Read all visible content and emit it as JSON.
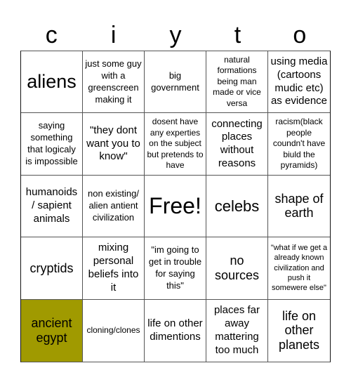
{
  "title_letters": [
    "c",
    "i",
    "y",
    "t",
    "o"
  ],
  "marked_color": "#a09a00",
  "cells": [
    {
      "text": "aliens",
      "marked": false
    },
    {
      "text": "just some guy with a greenscreen making it",
      "marked": false
    },
    {
      "text": "big government",
      "marked": false
    },
    {
      "text": "natural formations being man made or vice versa",
      "marked": false
    },
    {
      "text": "using media (cartoons mudic etc) as evidence",
      "marked": false
    },
    {
      "text": "saying something that logicaly is impossible",
      "marked": false
    },
    {
      "text": "\"they dont want you to know\"",
      "marked": false
    },
    {
      "text": "dosent have any experties on the subject but pretends to have",
      "marked": false
    },
    {
      "text": "connecting places without reasons",
      "marked": false
    },
    {
      "text": "racism(black people coundn't have biuld the pyramids)",
      "marked": false
    },
    {
      "text": "humanoids / sapient animals",
      "marked": false
    },
    {
      "text": "non existing/ alien antient civilization",
      "marked": false
    },
    {
      "text": "Free!",
      "marked": false
    },
    {
      "text": "celebs",
      "marked": false
    },
    {
      "text": "shape of earth",
      "marked": false
    },
    {
      "text": "cryptids",
      "marked": false
    },
    {
      "text": "mixing personal beliefs into it",
      "marked": false
    },
    {
      "text": "\"im going to get in trouble for saying this\"",
      "marked": false
    },
    {
      "text": "no sources",
      "marked": false
    },
    {
      "text": "\"what if we get a already known civilization and push it somewere else\"",
      "marked": false
    },
    {
      "text": "ancient egypt",
      "marked": true
    },
    {
      "text": "cloning/clones",
      "marked": false
    },
    {
      "text": "life on other dimentions",
      "marked": false
    },
    {
      "text": "places far away mattering too much",
      "marked": false
    },
    {
      "text": "life on other planets",
      "marked": false
    }
  ]
}
